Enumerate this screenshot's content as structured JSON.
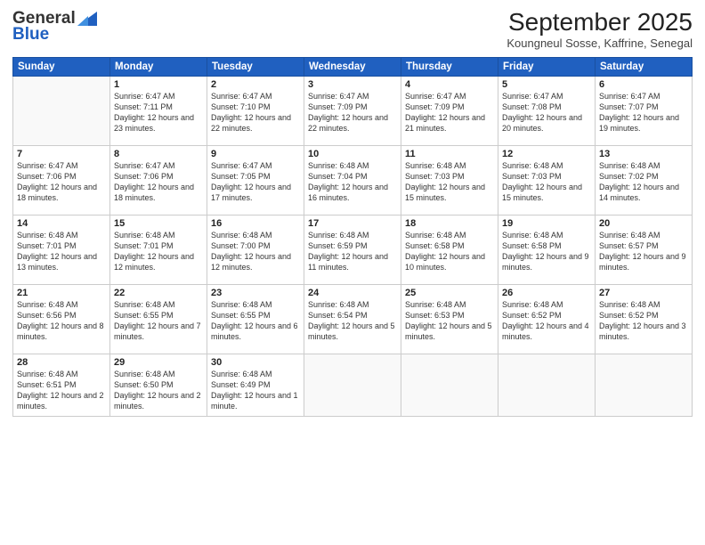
{
  "logo": {
    "general": "General",
    "blue": "Blue"
  },
  "header": {
    "title": "September 2025",
    "subtitle": "Koungneul Sosse, Kaffrine, Senegal"
  },
  "weekdays": [
    "Sunday",
    "Monday",
    "Tuesday",
    "Wednesday",
    "Thursday",
    "Friday",
    "Saturday"
  ],
  "weeks": [
    [
      {
        "day": "",
        "sunrise": "",
        "sunset": "",
        "daylight": ""
      },
      {
        "day": "1",
        "sunrise": "Sunrise: 6:47 AM",
        "sunset": "Sunset: 7:11 PM",
        "daylight": "Daylight: 12 hours and 23 minutes."
      },
      {
        "day": "2",
        "sunrise": "Sunrise: 6:47 AM",
        "sunset": "Sunset: 7:10 PM",
        "daylight": "Daylight: 12 hours and 22 minutes."
      },
      {
        "day": "3",
        "sunrise": "Sunrise: 6:47 AM",
        "sunset": "Sunset: 7:09 PM",
        "daylight": "Daylight: 12 hours and 22 minutes."
      },
      {
        "day": "4",
        "sunrise": "Sunrise: 6:47 AM",
        "sunset": "Sunset: 7:09 PM",
        "daylight": "Daylight: 12 hours and 21 minutes."
      },
      {
        "day": "5",
        "sunrise": "Sunrise: 6:47 AM",
        "sunset": "Sunset: 7:08 PM",
        "daylight": "Daylight: 12 hours and 20 minutes."
      },
      {
        "day": "6",
        "sunrise": "Sunrise: 6:47 AM",
        "sunset": "Sunset: 7:07 PM",
        "daylight": "Daylight: 12 hours and 19 minutes."
      }
    ],
    [
      {
        "day": "7",
        "sunrise": "Sunrise: 6:47 AM",
        "sunset": "Sunset: 7:06 PM",
        "daylight": "Daylight: 12 hours and 18 minutes."
      },
      {
        "day": "8",
        "sunrise": "Sunrise: 6:47 AM",
        "sunset": "Sunset: 7:06 PM",
        "daylight": "Daylight: 12 hours and 18 minutes."
      },
      {
        "day": "9",
        "sunrise": "Sunrise: 6:47 AM",
        "sunset": "Sunset: 7:05 PM",
        "daylight": "Daylight: 12 hours and 17 minutes."
      },
      {
        "day": "10",
        "sunrise": "Sunrise: 6:48 AM",
        "sunset": "Sunset: 7:04 PM",
        "daylight": "Daylight: 12 hours and 16 minutes."
      },
      {
        "day": "11",
        "sunrise": "Sunrise: 6:48 AM",
        "sunset": "Sunset: 7:03 PM",
        "daylight": "Daylight: 12 hours and 15 minutes."
      },
      {
        "day": "12",
        "sunrise": "Sunrise: 6:48 AM",
        "sunset": "Sunset: 7:03 PM",
        "daylight": "Daylight: 12 hours and 15 minutes."
      },
      {
        "day": "13",
        "sunrise": "Sunrise: 6:48 AM",
        "sunset": "Sunset: 7:02 PM",
        "daylight": "Daylight: 12 hours and 14 minutes."
      }
    ],
    [
      {
        "day": "14",
        "sunrise": "Sunrise: 6:48 AM",
        "sunset": "Sunset: 7:01 PM",
        "daylight": "Daylight: 12 hours and 13 minutes."
      },
      {
        "day": "15",
        "sunrise": "Sunrise: 6:48 AM",
        "sunset": "Sunset: 7:01 PM",
        "daylight": "Daylight: 12 hours and 12 minutes."
      },
      {
        "day": "16",
        "sunrise": "Sunrise: 6:48 AM",
        "sunset": "Sunset: 7:00 PM",
        "daylight": "Daylight: 12 hours and 12 minutes."
      },
      {
        "day": "17",
        "sunrise": "Sunrise: 6:48 AM",
        "sunset": "Sunset: 6:59 PM",
        "daylight": "Daylight: 12 hours and 11 minutes."
      },
      {
        "day": "18",
        "sunrise": "Sunrise: 6:48 AM",
        "sunset": "Sunset: 6:58 PM",
        "daylight": "Daylight: 12 hours and 10 minutes."
      },
      {
        "day": "19",
        "sunrise": "Sunrise: 6:48 AM",
        "sunset": "Sunset: 6:58 PM",
        "daylight": "Daylight: 12 hours and 9 minutes."
      },
      {
        "day": "20",
        "sunrise": "Sunrise: 6:48 AM",
        "sunset": "Sunset: 6:57 PM",
        "daylight": "Daylight: 12 hours and 9 minutes."
      }
    ],
    [
      {
        "day": "21",
        "sunrise": "Sunrise: 6:48 AM",
        "sunset": "Sunset: 6:56 PM",
        "daylight": "Daylight: 12 hours and 8 minutes."
      },
      {
        "day": "22",
        "sunrise": "Sunrise: 6:48 AM",
        "sunset": "Sunset: 6:55 PM",
        "daylight": "Daylight: 12 hours and 7 minutes."
      },
      {
        "day": "23",
        "sunrise": "Sunrise: 6:48 AM",
        "sunset": "Sunset: 6:55 PM",
        "daylight": "Daylight: 12 hours and 6 minutes."
      },
      {
        "day": "24",
        "sunrise": "Sunrise: 6:48 AM",
        "sunset": "Sunset: 6:54 PM",
        "daylight": "Daylight: 12 hours and 5 minutes."
      },
      {
        "day": "25",
        "sunrise": "Sunrise: 6:48 AM",
        "sunset": "Sunset: 6:53 PM",
        "daylight": "Daylight: 12 hours and 5 minutes."
      },
      {
        "day": "26",
        "sunrise": "Sunrise: 6:48 AM",
        "sunset": "Sunset: 6:52 PM",
        "daylight": "Daylight: 12 hours and 4 minutes."
      },
      {
        "day": "27",
        "sunrise": "Sunrise: 6:48 AM",
        "sunset": "Sunset: 6:52 PM",
        "daylight": "Daylight: 12 hours and 3 minutes."
      }
    ],
    [
      {
        "day": "28",
        "sunrise": "Sunrise: 6:48 AM",
        "sunset": "Sunset: 6:51 PM",
        "daylight": "Daylight: 12 hours and 2 minutes."
      },
      {
        "day": "29",
        "sunrise": "Sunrise: 6:48 AM",
        "sunset": "Sunset: 6:50 PM",
        "daylight": "Daylight: 12 hours and 2 minutes."
      },
      {
        "day": "30",
        "sunrise": "Sunrise: 6:48 AM",
        "sunset": "Sunset: 6:49 PM",
        "daylight": "Daylight: 12 hours and 1 minute."
      },
      {
        "day": "",
        "sunrise": "",
        "sunset": "",
        "daylight": ""
      },
      {
        "day": "",
        "sunrise": "",
        "sunset": "",
        "daylight": ""
      },
      {
        "day": "",
        "sunrise": "",
        "sunset": "",
        "daylight": ""
      },
      {
        "day": "",
        "sunrise": "",
        "sunset": "",
        "daylight": ""
      }
    ]
  ]
}
